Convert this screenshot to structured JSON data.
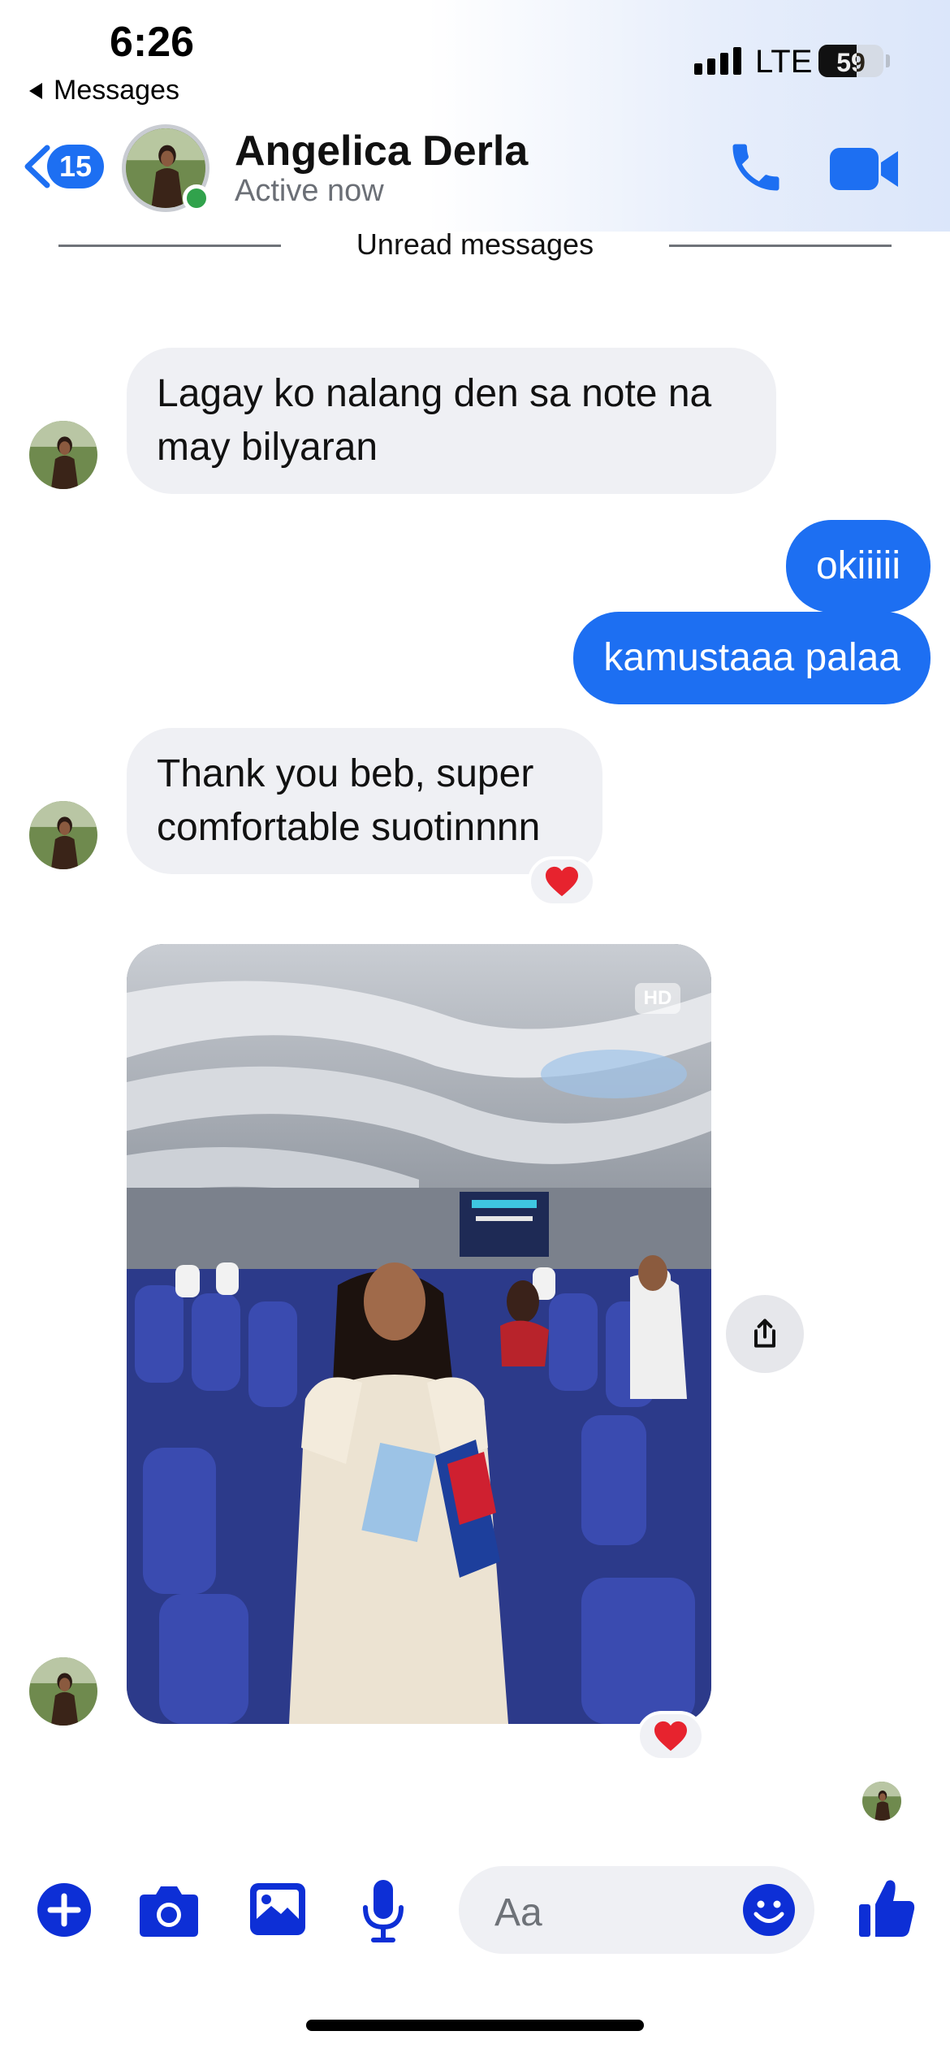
{
  "status_bar": {
    "time": "6:26",
    "back_app_label": "Messages",
    "network": "LTE",
    "battery_level": "59",
    "battery_percent": 59
  },
  "header": {
    "unread_count": "15",
    "contact_name": "Angelica Derla",
    "contact_status": "Active now",
    "online": true,
    "accent_color": "#1d6ff2"
  },
  "divider_label": "Unread messages",
  "messages": [
    {
      "direction": "incoming",
      "text": "Lagay ko nalang den sa note na may bilyaran"
    },
    {
      "direction": "outgoing",
      "text": "okiiiii"
    },
    {
      "direction": "outgoing",
      "text": "kamustaaa palaa"
    },
    {
      "direction": "incoming",
      "text": "Thank you beb, super comfortable suotinnnn",
      "reaction": "❤️"
    },
    {
      "direction": "incoming",
      "type": "photo",
      "badge": "HD",
      "reaction": "❤️"
    }
  ],
  "composer": {
    "placeholder": "Aa",
    "icons": [
      "plus-icon",
      "camera-icon",
      "gallery-icon",
      "microphone-icon",
      "emoji-icon",
      "thumbs-up-icon"
    ]
  }
}
